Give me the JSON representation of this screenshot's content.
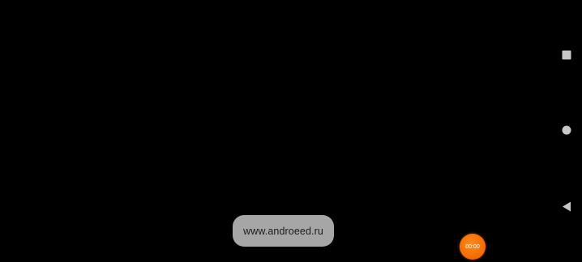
{
  "toast": {
    "text": "www.androeed.ru"
  },
  "recorder": {
    "timer": "00:00",
    "color": "#f26a00"
  },
  "navigation": {
    "recents_icon": "square-icon",
    "home_icon": "circle-icon",
    "back_icon": "triangle-back-icon",
    "icon_color": "#c8c8c8"
  }
}
